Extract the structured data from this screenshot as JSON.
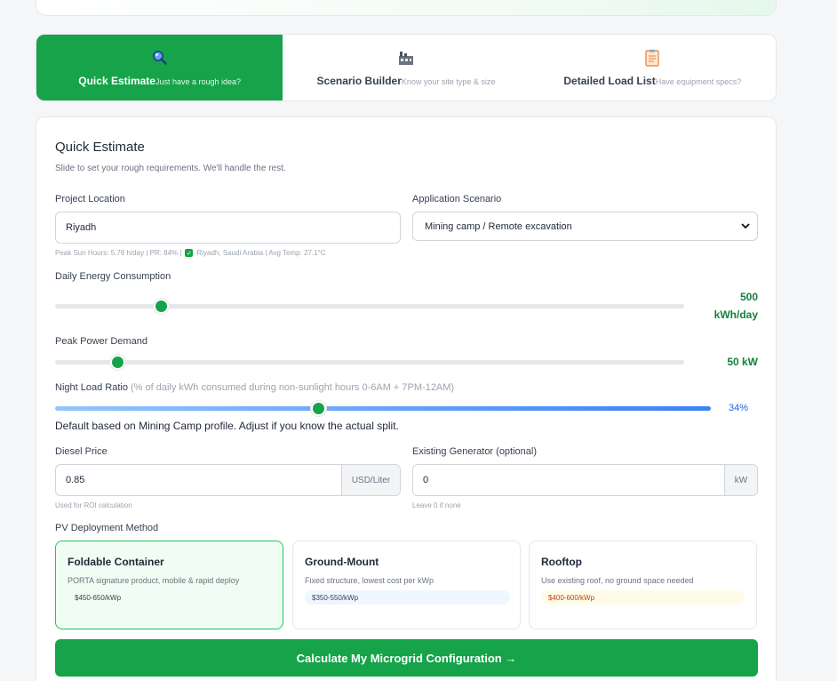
{
  "tabs": [
    {
      "title": "Quick Estimate",
      "sub": "Just have a rough idea?",
      "icon": "magnifier-icon",
      "active": true
    },
    {
      "title": "Scenario Builder",
      "sub": "Know your site type & size",
      "icon": "factory-icon",
      "active": false
    },
    {
      "title": "Detailed Load List",
      "sub": "Have equipment specs?",
      "icon": "clipboard-icon",
      "active": false
    }
  ],
  "form": {
    "title": "Quick Estimate",
    "subtitle": "Slide to set your rough requirements. We'll handle the rest.",
    "location": {
      "label": "Project Location",
      "value": "Riyadh",
      "hint_left": "Peak Sun Hours: 5.76 h/day | PR: 84% |",
      "hint_right": "Riyadh, Saudi Arabia | Avg Temp: 27.1°C"
    },
    "scenario": {
      "label": "Application Scenario",
      "value": "Mining camp / Remote excavation"
    },
    "daily_energy": {
      "label": "Daily Energy Consumption",
      "value": "500",
      "unit": "kWh/day",
      "fraction": 0.17
    },
    "peak_power": {
      "label": "Peak Power Demand",
      "value": "50 kW",
      "fraction": 0.1
    },
    "night_ratio": {
      "label": "Night Load Ratio",
      "detail": "(% of daily kWh consumed during non-sunlight hours 0-6AM + 7PM-12AM)",
      "value": "34%",
      "fraction": 0.34,
      "note": "Default based on Mining Camp profile. Adjust if you know the actual split."
    },
    "diesel": {
      "label": "Diesel Price",
      "value": "0.85",
      "unit": "USD/Liter",
      "hint": "Used for ROI calculation"
    },
    "generator": {
      "label": "Existing Generator (optional)",
      "value": "0",
      "unit": "kW",
      "hint": "Leave 0 if none"
    },
    "pv": {
      "label": "PV Deployment Method",
      "options": [
        {
          "title": "Foldable Container",
          "desc": "PORTA signature product, mobile & rapid deploy",
          "price": "$450-650/kWp",
          "selected": true
        },
        {
          "title": "Ground-Mount",
          "desc": "Fixed structure, lowest cost per kWp",
          "price": "$350-550/kWp",
          "selected": false
        },
        {
          "title": "Rooftop",
          "desc": "Use existing roof, no ground space needed",
          "price": "$400-600/kWp",
          "selected": false
        }
      ]
    },
    "cta": "Calculate My Microgrid Configuration →"
  },
  "colors": {
    "accent": "#16a34a",
    "blue": "#3b82f6"
  }
}
